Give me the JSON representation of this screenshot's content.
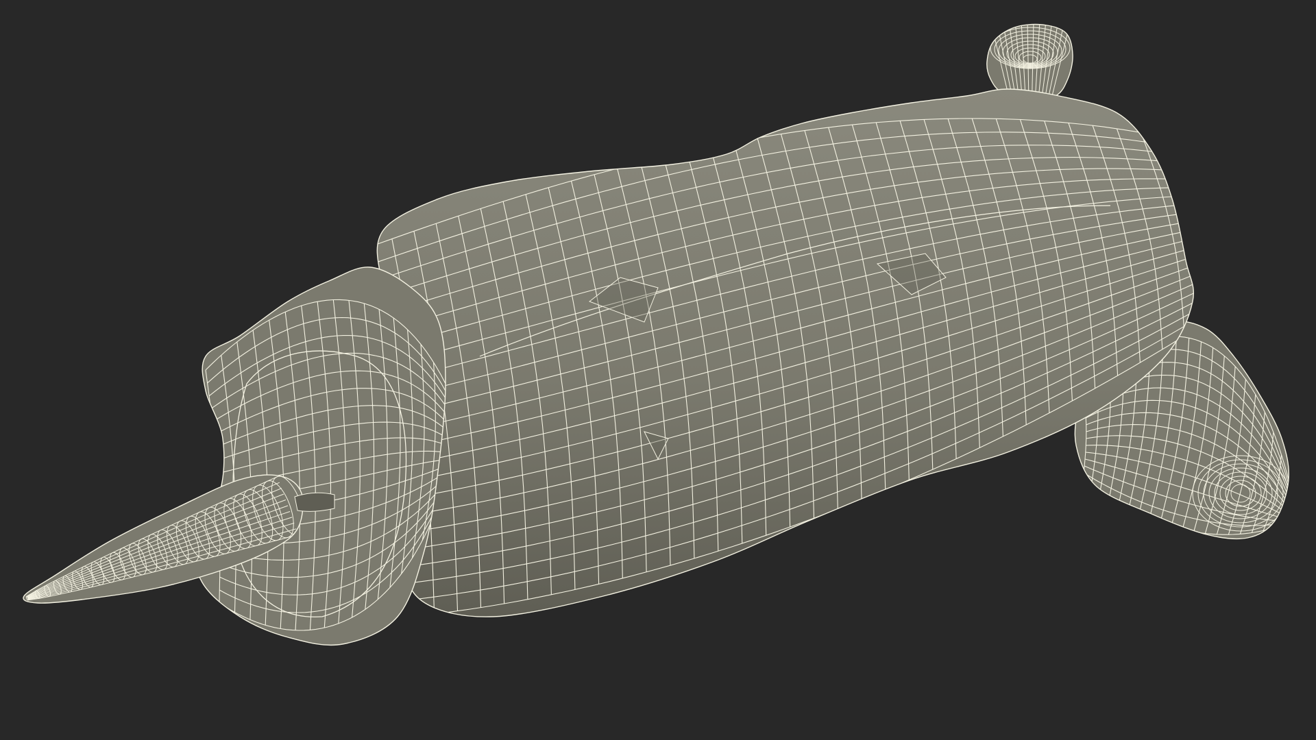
{
  "render": {
    "background_color": "#282828",
    "surface_color": "#7b7a6e",
    "surface_shadow_color": "#5f5e54",
    "surface_highlight_color": "#8a897d",
    "wire_color": "#f4f2e2"
  }
}
